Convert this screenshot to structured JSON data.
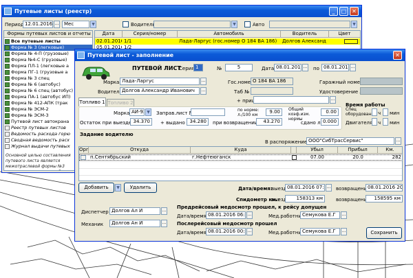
{
  "register": {
    "title": "Путевые листы (реестр)",
    "period_label": "Период",
    "period_date": "12.01.2016",
    "period_unit": "Мес",
    "driver_label": "Водитель",
    "auto_label": "Авто",
    "tree_header": "Формы путевых листов и отчеты",
    "tree_items": [
      {
        "label": "Все путевые листы",
        "bold": true,
        "italic": false
      },
      {
        "label": "Форма № 3 (легковые)",
        "bold": false,
        "italic": false
      },
      {
        "label": "Форма № 4-П (грузовые)",
        "bold": false,
        "italic": false
      },
      {
        "label": "Форма №4-С (грузовые)",
        "bold": false,
        "italic": false
      },
      {
        "label": "Форма ПЛ-1 (легковые а",
        "bold": false,
        "italic": false
      },
      {
        "label": "Форма ПГ-1 (грузовые а",
        "bold": false,
        "italic": false
      },
      {
        "label": "Форма № 3 спец",
        "bold": false,
        "italic": false
      },
      {
        "label": "Форма № 6 (автобус)",
        "bold": false,
        "italic": false
      },
      {
        "label": "Форма № 6 спец (автобус)",
        "bold": false,
        "italic": false
      },
      {
        "label": "Форма ПА-1 (автобус ИП)",
        "bold": false,
        "italic": false
      },
      {
        "label": "Форма № 412-АПК (трак",
        "bold": false,
        "italic": false
      },
      {
        "label": "Форма № ЭСМ-2",
        "bold": false,
        "italic": false
      },
      {
        "label": "Форма № ЭСМ-3",
        "bold": false,
        "italic": false
      },
      {
        "label": "Путевой лист автокрана",
        "bold": false,
        "italic": false
      },
      {
        "label": "Реестр путевых листов",
        "bold": false,
        "italic": true
      },
      {
        "label": "Ведомость расхода горю",
        "bold": false,
        "italic": true
      },
      {
        "label": "Сводная ведомость расх",
        "bold": false,
        "italic": true
      },
      {
        "label": "Журнал выдачи путевых",
        "bold": false,
        "italic": true
      }
    ],
    "note": "Основной целью составления путевого листа является межотраслевой формы №3 листа легкового автомоби",
    "columns": [
      "Дата",
      "Серия/номер",
      "Автомобиль",
      "Водитель",
      "Цвет"
    ],
    "rows": [
      {
        "date": "02.01.2016",
        "number": "1/1",
        "car": "Лада-Ларгус (гос.номер О 184 ВА 186)",
        "driver": "Долгов Александ",
        "color": "#ffff00"
      },
      {
        "date": "05.01.2016",
        "number": "1/2",
        "car": "",
        "driver": "",
        "color": ""
      }
    ]
  },
  "waybill": {
    "title": "Путевой лист - заполнение",
    "heading": "ПУТЕВОЙ ЛИСТ",
    "series_label": "Серия",
    "series_value": "1",
    "number_label": "№",
    "number_value": "5",
    "date_label": "Дата",
    "date_value": "08.01.2016",
    "to_label": "по",
    "to_value": "08.01.2016",
    "brand_label": "Марка",
    "brand_value": "Лада-Ларгус",
    "plate_label": "Гос.номер",
    "plate_value": "О 184 ВА 186",
    "garage_label": "Гаражный номер",
    "garage_value": "",
    "driver_label": "Водитель",
    "driver_value": "Долгов Александр Иванович",
    "tab_label": "Таб №",
    "tab_value": "",
    "license_label": "Удостоверение №",
    "license_value": "",
    "trailer_label": "+ прицеп",
    "tab1": "Топливо 1",
    "tab2": "Топливо 2",
    "fuel_brand_label": "Марка",
    "fuel_brand_value": "АИ-92",
    "refuel_label": "Заправ.лист №",
    "refuel_value": "",
    "norm_label": "по норме: л./100 км",
    "norm_value": "9.00",
    "coef_label": "Общий коэф.изм. нормы",
    "coef_value": "0.00",
    "worktime_label": "Время работы",
    "spec_label": "Спец оборудования",
    "engine_label": "Двигателя",
    "hours_unit": "ч",
    "min_unit": "мин",
    "rest_out_label": "Остаток при выезде, л",
    "rest_out_value": "34.370",
    "issued_label": "+ выдано л.",
    "issued_value": "34.280",
    "rest_back_label": "при возвращении",
    "rest_back_value": "43.270",
    "returned_label": "сдано л.",
    "returned_value": "0.000",
    "task_label": "Задание водителю",
    "dispose_label": "В распоряжение",
    "dispose_value": "ООО\"СибТрасСервис\"",
    "route_columns": [
      "Орг",
      "Откуда",
      "Куда",
      "Убыл",
      "Прибыл",
      "Км."
    ],
    "routes": [
      {
        "from": "п.Сентябрьский",
        "to": "г.Нефтеюганск",
        "left": "07.00",
        "arrived": "20.0",
        "km": "282"
      }
    ],
    "add_button": "Добавить",
    "delete_button": "Удалить",
    "datetime_label": "Дата/время:",
    "departure_label": "выезд",
    "departure_value": "08.01.2016 07:00",
    "return_label": "возвращение",
    "return_value": "08.01.2016 20:00",
    "odometer_label": "Спидометр км.:",
    "odo_out_label": "выезд",
    "odo_out_value": "158313 км",
    "odo_back_label": "возвращение",
    "odo_back_value": "158595 км",
    "dispatcher_label": "Диспетчер",
    "dispatcher_value": "Долгов Ал И",
    "mechanic_label": "Механик",
    "mechanic_value": "Долгов Ан И",
    "pre_med_label": "Предрейсовый медосмотр прошел, к рейсу допущен",
    "post_med_label": "Послерейсовый медосмотр прошел",
    "med_dt_label": "Дата/время:",
    "pre_med_dt": "08.01.2016 06:00",
    "post_med_dt": "08.01.2016 00:00",
    "med_worker_label": "Мед.работник",
    "pre_med_worker": "Семукова Е.Г",
    "post_med_worker": "Семукова Е.Г",
    "save_button": "Сохранить"
  }
}
